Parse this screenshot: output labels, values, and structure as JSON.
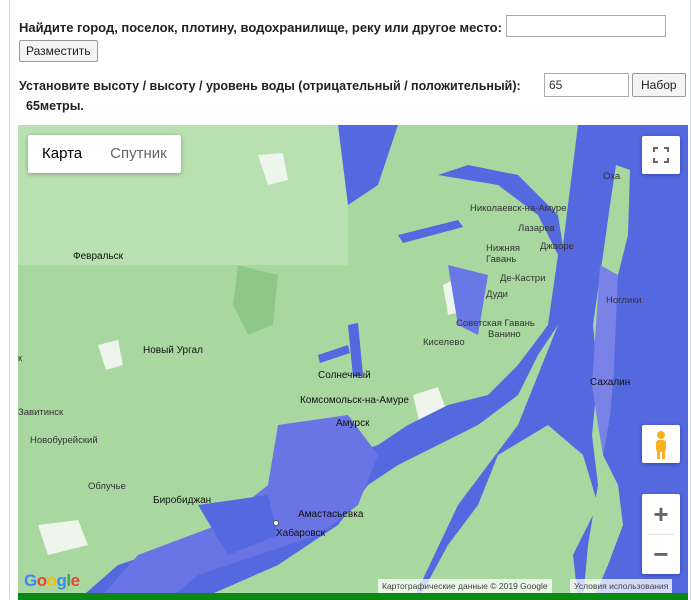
{
  "form": {
    "search_label": "Найдите город, поселок, плотину, водохранилище, реку или другое место:",
    "search_value": "",
    "place_button": "Разместить",
    "height_label": "Установите высоту / высоту / уровень воды (отрицательный / положительный):",
    "height_value": "65",
    "set_button": "Набор",
    "current_height": "65метры."
  },
  "map": {
    "type_options": [
      "Карта",
      "Спутник"
    ],
    "selected_type": "Карта",
    "labels": {
      "fevralsk": "Февральск",
      "novy_urgal": "Новый Ургал",
      "solnechny": "Солнечный",
      "komsomolsk": "Комсомольск-на-Амуре",
      "amursk": "Амурск",
      "birobidzhan": "Биробиджан",
      "khabarovsk": "Хабаровск",
      "amurzet": "Амастасьевка",
      "obluchye": "Облучье",
      "novobureysky": "Новобурейский",
      "zavitinsk": "Завитинск",
      "sakhalin": "Сахалин",
      "nikolaevsk": "Николаевск-на-Амуре",
      "lazarev": "Лазарев",
      "dzhaore": "Джаоре",
      "nizhnyaya_gavan": "Нижняя Гавань",
      "de_kastri": "Де-Кастри",
      "sovgavan": "Советская Гавань",
      "vanino": "Ванино",
      "kiselev": "Киселево",
      "dudi": "Дуди",
      "okha": "Оха",
      "nogliki": "Ноглики",
      "left_k": "к"
    },
    "attribution": "Картографические данные © 2019 Google",
    "terms": "Условия использования",
    "logo": "Google"
  },
  "colors": {
    "water": "#5468e0",
    "land": "#a8d8a0",
    "flood_green": "#0a8a12"
  },
  "icons": {
    "fullscreen": "fullscreen-icon",
    "pegman": "pegman-icon",
    "zoom_in": "plus-icon",
    "zoom_out": "minus-icon"
  }
}
